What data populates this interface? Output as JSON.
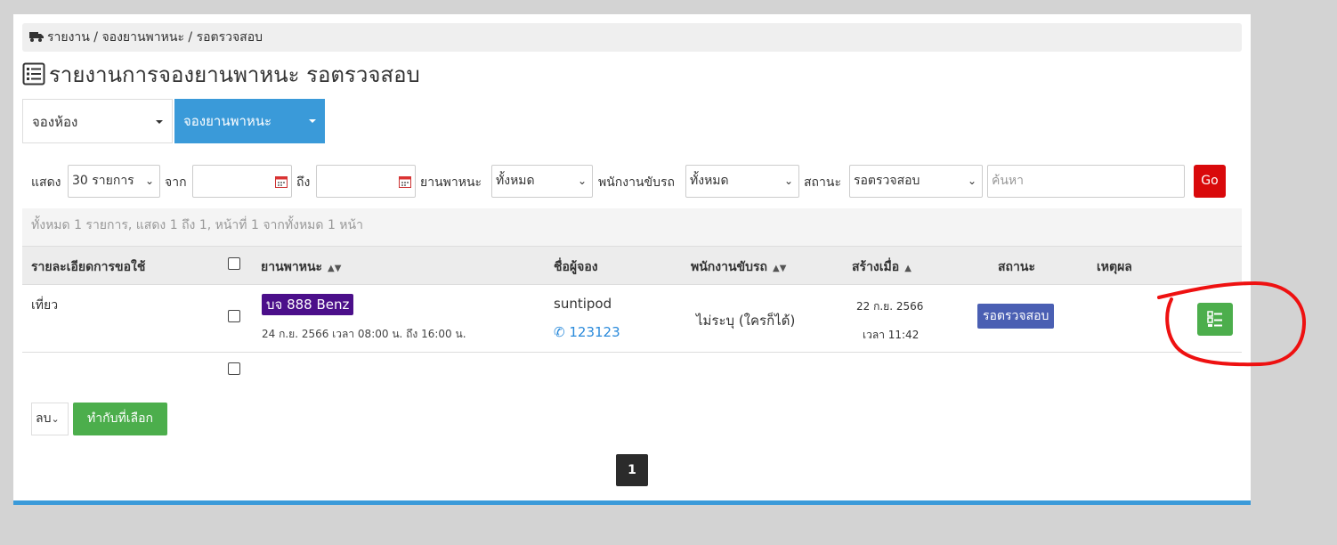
{
  "breadcrumb": {
    "text": "รายงาน / จองยานพาหนะ / รอตรวจสอบ",
    "icon": "truck-icon"
  },
  "page_title": "รายงานการจองยานพาหนะ รอตรวจสอบ",
  "tabs": [
    {
      "label": "จองห้อง",
      "active": false
    },
    {
      "label": "จองยานพาหนะ",
      "active": true
    }
  ],
  "filters": {
    "show_label": "แสดง",
    "show_value": "30 รายการ",
    "from_label": "จาก",
    "to_label": "ถึง",
    "vehicle_label": "ยานพาหนะ",
    "vehicle_value": "ทั้งหมด",
    "driver_label": "พนักงานขับรถ",
    "driver_value": "ทั้งหมด",
    "status_label": "สถานะ",
    "status_value": "รอตรวจสอบ",
    "search_placeholder": "ค้นหา",
    "go_label": "Go"
  },
  "summary": "ทั้งหมด 1 รายการ, แสดง 1 ถึง 1, หน้าที่ 1 จากทั้งหมด 1 หน้า",
  "table": {
    "headers": {
      "detail": "รายละเอียดการขอใช้",
      "vehicle": "ยานพาหนะ",
      "booker": "ชื่อผู้จอง",
      "driver": "พนักงานขับรถ",
      "created": "สร้างเมื่อ",
      "status": "สถานะ",
      "reason": "เหตุผล"
    },
    "rows": [
      {
        "detail": "เที่ยว",
        "vehicle_plate": "บจ 888 Benz",
        "vehicle_time": "24 ก.ย. 2566 เวลา 08:00 น. ถึง 16:00 น.",
        "booker_name": "suntipod",
        "booker_phone": "123123",
        "driver": "ไม่ระบุ (ใครก็ได้)",
        "created_date": "22 ก.ย. 2566",
        "created_time": "เวลา 11:42",
        "status": "รอตรวจสอบ",
        "reason": ""
      }
    ]
  },
  "bulk": {
    "action_value": "ลบ",
    "apply_label": "ทำกับที่เลือก"
  },
  "pagination": {
    "current_page": "1"
  },
  "colors": {
    "accent": "#3a9ad9",
    "danger": "#d9090b",
    "success": "#4cae4c",
    "plate": "#4b0f8a",
    "status": "#4a5fb3",
    "annotation": "#ee1111"
  }
}
